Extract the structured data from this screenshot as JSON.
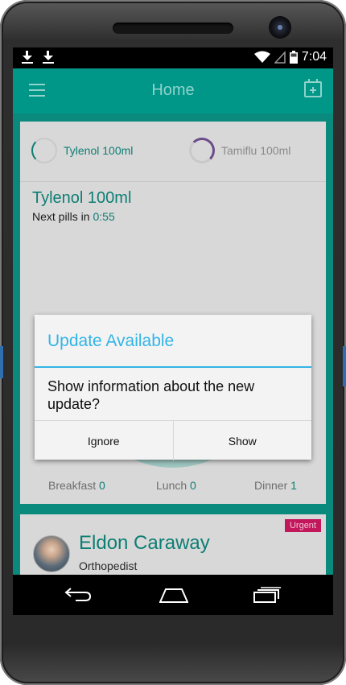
{
  "status_bar": {
    "time": "7:04",
    "icons": [
      "download-icon",
      "download-icon",
      "wifi-icon",
      "signal-icon",
      "battery-icon"
    ]
  },
  "app_bar": {
    "title": "Home",
    "menu_icon": "hamburger-icon",
    "action_icon": "calendar-add-icon"
  },
  "medications": {
    "tabs": [
      {
        "label": "Tylenol 100ml",
        "color": "#0d7e74"
      },
      {
        "label": "Tamiflu 100ml",
        "color": "#8a8a8a"
      }
    ],
    "selected_name": "Tylenol 100ml",
    "next_label": "Next pills in",
    "next_value": "0:55",
    "meals": [
      {
        "label": "Breakfast",
        "count": "0"
      },
      {
        "label": "Lunch",
        "count": "0"
      },
      {
        "label": "Dinner",
        "count": "1"
      }
    ]
  },
  "doctor": {
    "name": "Eldon Caraway",
    "specialty": "Orthopedist",
    "badge": "Urgent"
  },
  "dialog": {
    "title": "Update Available",
    "message": "Show information about the new update?",
    "buttons": {
      "negative": "Ignore",
      "positive": "Show"
    }
  },
  "colors": {
    "primary": "#009688",
    "dialog_accent": "#33b5e5",
    "urgent": "#c2185b"
  }
}
